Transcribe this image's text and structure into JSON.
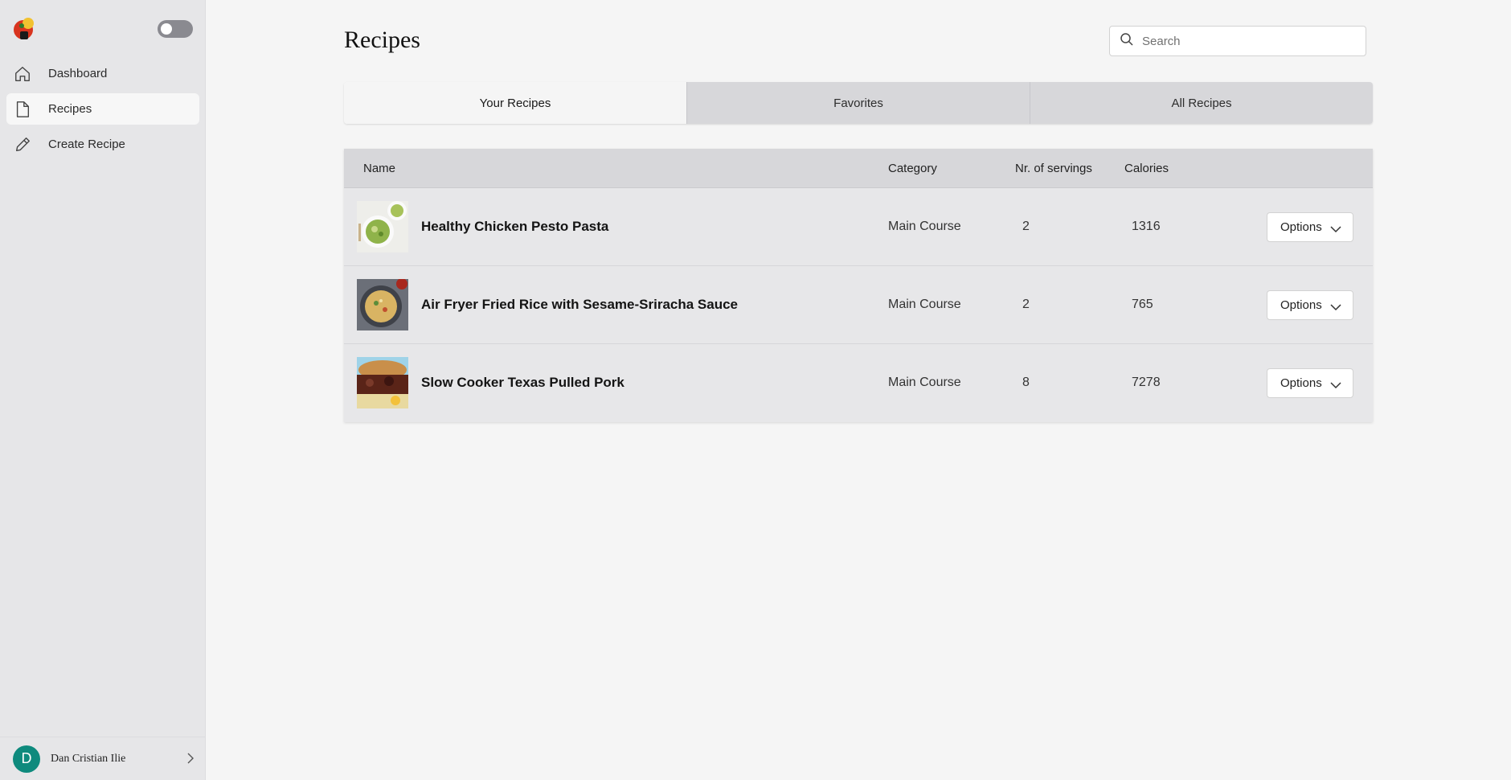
{
  "sidebar": {
    "logo_icon": "chef-hat-logo-icon",
    "theme_toggle": {
      "state": "off"
    },
    "items": [
      {
        "label": "Dashboard",
        "icon": "home-icon",
        "active": false
      },
      {
        "label": "Recipes",
        "icon": "document-icon",
        "active": true
      },
      {
        "label": "Create Recipe",
        "icon": "pencil-icon",
        "active": false
      }
    ],
    "user": {
      "initial": "D",
      "name": "Dan Cristian Ilie",
      "avatar_color": "#0e8a7d"
    }
  },
  "main": {
    "title": "Recipes",
    "search": {
      "placeholder": "Search",
      "value": ""
    },
    "tabs": [
      {
        "label": "Your Recipes",
        "active": true
      },
      {
        "label": "Favorites",
        "active": false
      },
      {
        "label": "All Recipes",
        "active": false
      }
    ],
    "table": {
      "columns": {
        "name": "Name",
        "category": "Category",
        "servings": "Nr. of servings",
        "calories": "Calories"
      },
      "rows": [
        {
          "name": "Healthy Chicken Pesto Pasta",
          "category": "Main Course",
          "servings": "2",
          "calories": "1316",
          "options_label": "Options"
        },
        {
          "name": "Air Fryer Fried Rice with Sesame-Sriracha Sauce",
          "category": "Main Course",
          "servings": "2",
          "calories": "765",
          "options_label": "Options"
        },
        {
          "name": "Slow Cooker Texas Pulled Pork",
          "category": "Main Course",
          "servings": "8",
          "calories": "7278",
          "options_label": "Options"
        }
      ]
    }
  }
}
